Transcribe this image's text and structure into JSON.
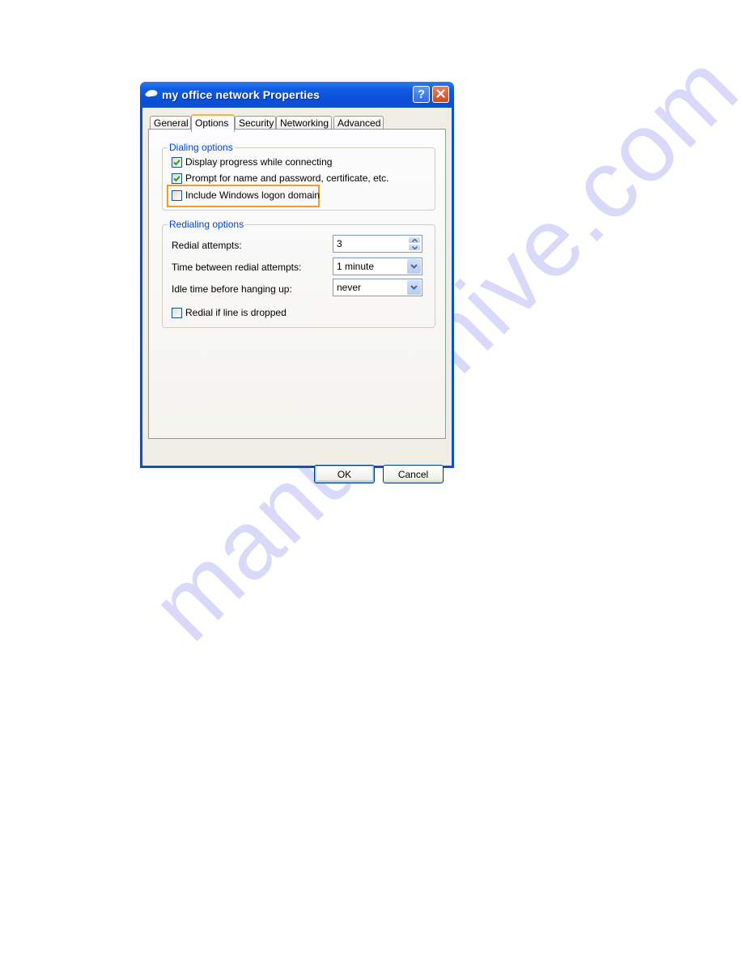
{
  "window": {
    "title": "my office network Properties",
    "icon": "network-connection-icon",
    "help_label": "?",
    "close_label": "✕"
  },
  "tabs": [
    {
      "label": "General",
      "active": false
    },
    {
      "label": "Options",
      "active": true
    },
    {
      "label": "Security",
      "active": false
    },
    {
      "label": "Networking",
      "active": false
    },
    {
      "label": "Advanced",
      "active": false
    }
  ],
  "dialing_options": {
    "label": "Dialing options",
    "items": [
      {
        "label": "Display progress while connecting",
        "checked": true
      },
      {
        "label": "Prompt for name and password, certificate, etc.",
        "checked": true
      },
      {
        "label": "Include Windows logon domain",
        "checked": false,
        "highlighted": true
      }
    ]
  },
  "redialing_options": {
    "label": "Redialing options",
    "redial_attempts": {
      "label": "Redial attempts:",
      "value": "3"
    },
    "time_between": {
      "label": "Time between redial attempts:",
      "value": "1 minute"
    },
    "idle_time": {
      "label": "Idle time before hanging up:",
      "value": "never"
    },
    "redial_if_dropped": {
      "label": "Redial if line is dropped",
      "checked": false
    }
  },
  "buttons": {
    "ok": "OK",
    "cancel": "Cancel"
  },
  "colors": {
    "highlight_border": "#f39a2b",
    "group_label": "#0046d5",
    "titlebar": "#0a4fd8",
    "check_mark": "#21a121"
  },
  "watermark": "manualshive.com"
}
